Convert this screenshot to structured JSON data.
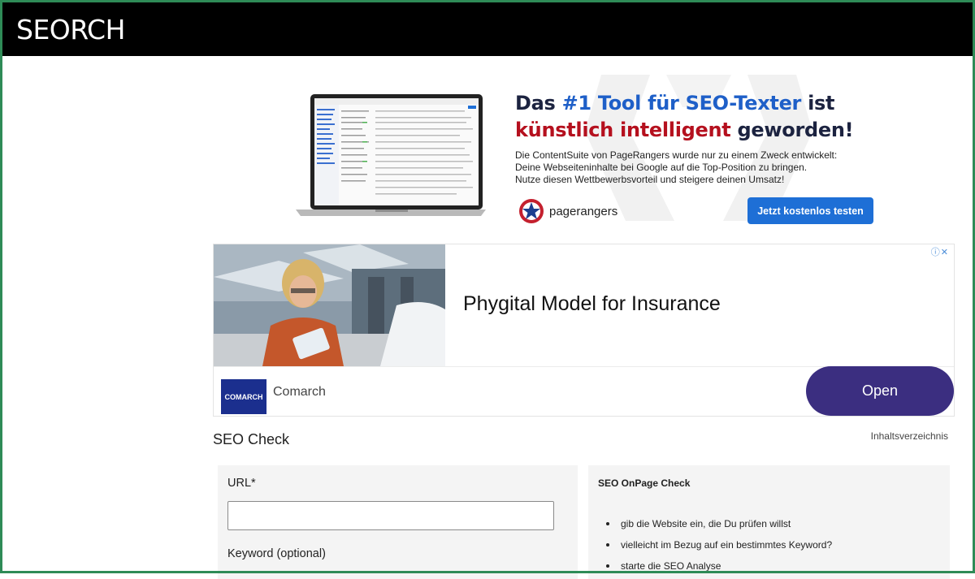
{
  "site": {
    "logo_text": "SEORCH"
  },
  "pr_banner": {
    "headline_1_pre": "Das ",
    "headline_1_blue": "#1 Tool für SEO-Texter",
    "headline_1_post": " ist",
    "headline_2_red": "künstlich intelligent",
    "headline_2_post": " geworden!",
    "body_lines": [
      "Die ContentSuite von PageRangers wurde nur zu einem Zweck entwickelt:",
      "Deine Webseiteninhalte bei Google auf die Top-Position zu bringen.",
      "Nutze diesen Wettbewerbsvorteil und steigere deinen Umsatz!"
    ],
    "brand": "pagerangers",
    "cta_label": "Jetzt kostenlos testen",
    "colors": {
      "blue": "#1e5fc8",
      "red": "#b5101e",
      "cta": "#1e6fd6"
    }
  },
  "ad": {
    "headline": "Phygital Model for Insurance",
    "brand_logo_text": "COMARCH",
    "brand_name": "Comarch",
    "open_label": "Open",
    "info_icons": "ⓘ✕",
    "colors": {
      "open_button": "#3b2e80",
      "logo_bg": "#1b2f8e"
    }
  },
  "seo_check": {
    "title": "SEO Check",
    "toc_link": "Inhaltsverzeichnis",
    "form": {
      "url_label": "URL*",
      "url_value": "",
      "keyword_label": "Keyword (optional)"
    },
    "info": {
      "title": "SEO OnPage Check",
      "items": [
        "gib die Website ein, die Du prüfen willst",
        "vielleicht im Bezug auf ein bestimmtes Keyword?",
        "starte die SEO Analyse"
      ]
    }
  }
}
